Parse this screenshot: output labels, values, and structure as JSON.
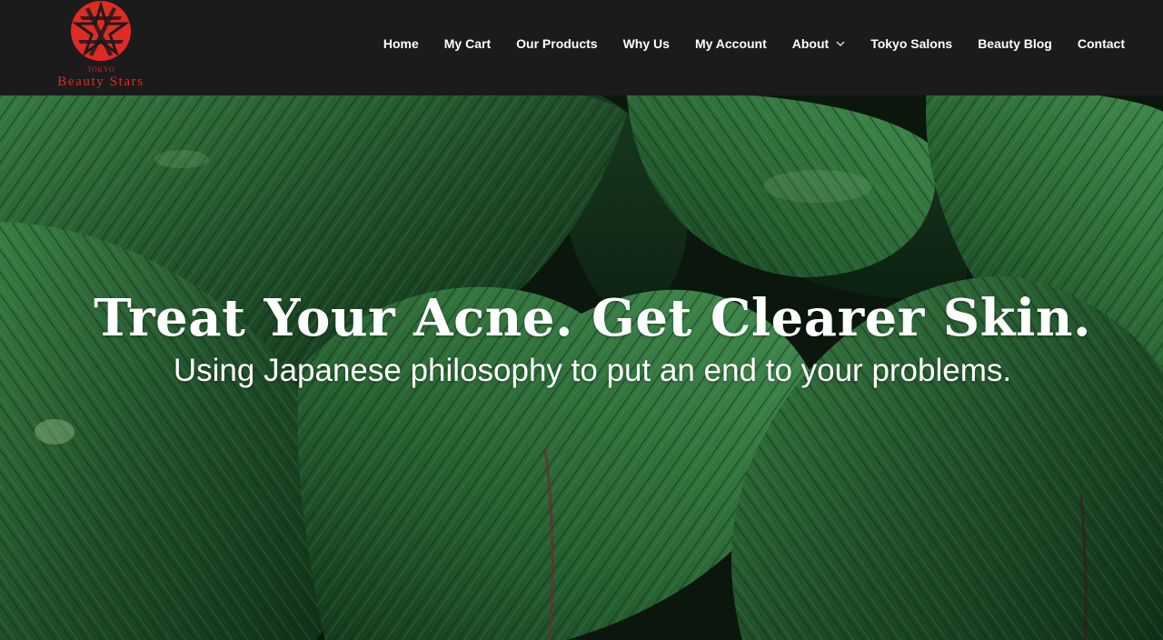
{
  "brand": {
    "small_text": "TOKYO",
    "name": "Beauty Stars",
    "logo_color": "#e02a25"
  },
  "nav": {
    "items": [
      {
        "label": "Home"
      },
      {
        "label": "My Cart"
      },
      {
        "label": "Our Products"
      },
      {
        "label": "Why Us"
      },
      {
        "label": "My Account"
      },
      {
        "label": "About",
        "has_dropdown": true,
        "icon": "chevron-down-icon"
      },
      {
        "label": "Tokyo Salons"
      },
      {
        "label": "Beauty Blog"
      },
      {
        "label": "Contact"
      }
    ]
  },
  "hero": {
    "title": "Treat Your Acne. Get Clearer Skin.",
    "subtitle": "Using Japanese philosophy to put an end to your problems.",
    "background": "tropical green leaves photo"
  },
  "colors": {
    "header_bg": "#1b1b1b",
    "nav_text": "#ffffff",
    "leaf_green": "#2e6b3a"
  }
}
